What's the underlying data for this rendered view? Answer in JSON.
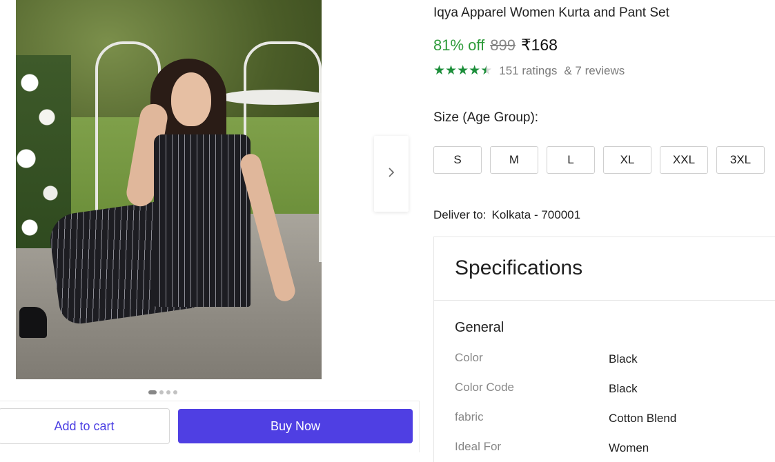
{
  "product": {
    "title": "Iqya Apparel Women Kurta and Pant Set",
    "discount": "81% off",
    "mrp": "899",
    "price": "₹168",
    "rating": 4.5,
    "ratings_text": "151 ratings",
    "reviews_text": "& 7 reviews"
  },
  "gallery": {
    "image_count": 4,
    "active_index": 0
  },
  "size": {
    "label": "Size (Age Group):",
    "options": [
      "S",
      "M",
      "L",
      "XL",
      "XXL",
      "3XL"
    ]
  },
  "delivery": {
    "label": "Deliver to:",
    "location": "Kolkata - 700001"
  },
  "specifications": {
    "title": "Specifications",
    "group": "General",
    "rows": [
      {
        "key": "Color",
        "value": "Black"
      },
      {
        "key": "Color Code",
        "value": "Black"
      },
      {
        "key": "fabric",
        "value": "Cotton Blend"
      },
      {
        "key": "Ideal For",
        "value": "Women"
      }
    ]
  },
  "actions": {
    "add_to_cart": "Add to cart",
    "buy_now": "Buy Now"
  },
  "colors": {
    "accent": "#4f3fe3",
    "discount_green": "#2e9b3a",
    "star_green": "#1c8e3a"
  },
  "icons": {
    "next": "chevron-right-icon",
    "star": "star-icon"
  }
}
